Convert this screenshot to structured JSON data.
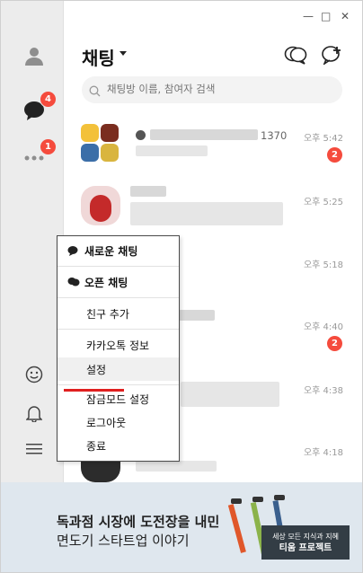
{
  "window": {
    "minimize": "—",
    "maximize": "□",
    "close": "✕"
  },
  "sidebar": {
    "friends_icon": "person-icon",
    "chats_badge": "4",
    "more_badge": "1"
  },
  "header": {
    "title": "채팅",
    "new_open_chat_icon": "open-chat-icon",
    "new_chat_icon": "new-chat-icon"
  },
  "search": {
    "placeholder": "채팅방 이름, 참여자 검색"
  },
  "chats": [
    {
      "count": "1370",
      "time": "오후 5:42",
      "unread": "2"
    },
    {
      "time": "오후 5:25"
    },
    {
      "time": "오후 5:18"
    },
    {
      "time": "오후 4:40",
      "unread": "2"
    },
    {
      "time": "오후 4:38"
    },
    {
      "time": "오후 4:18"
    }
  ],
  "menu": {
    "new_chat": "새로운 채팅",
    "open_chat": "오픈 채팅",
    "add_friend": "친구 추가",
    "kakao_info": "카카오톡 정보",
    "settings": "설정",
    "lock_mode": "잠금모드 설정",
    "logout": "로그아웃",
    "exit": "종료"
  },
  "ad": {
    "line1": "독과점 시장에 도전장을 내민",
    "line2": "면도기 스타트업 이야기",
    "badge_line1": "세상 모든 지식과 지혜",
    "badge_line2": "티움 프로젝트"
  },
  "colors": {
    "badge_red": "#f54b3d",
    "sidebar_bg": "#ececec",
    "ad_bg": "#dfe7ee"
  }
}
